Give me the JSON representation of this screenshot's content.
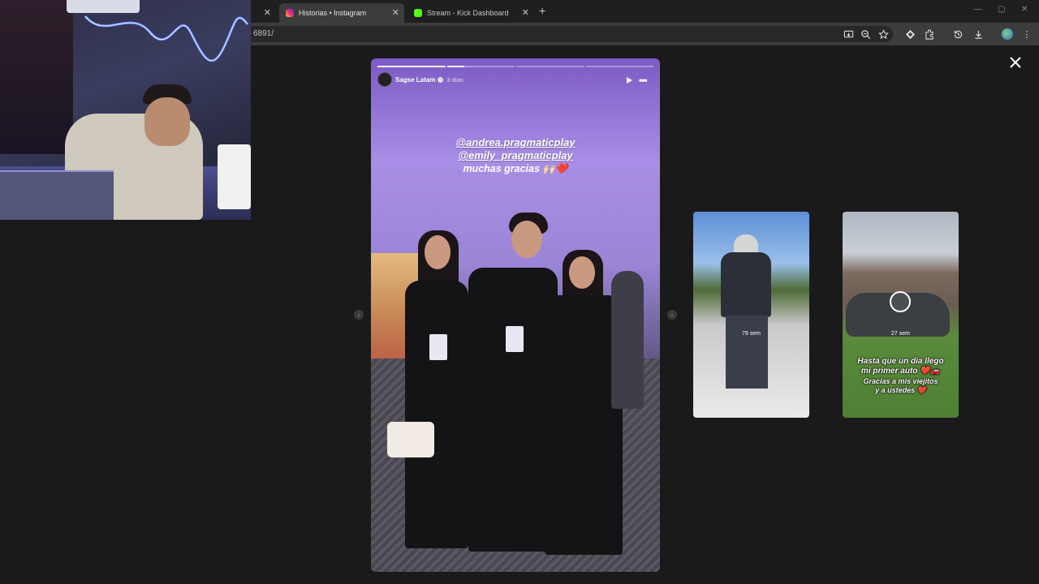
{
  "browser": {
    "tabs": [
      {
        "label": "",
        "active": false
      },
      {
        "label": "Historias • Instagram",
        "active": true
      },
      {
        "label": "Stream - Kick Dashboard",
        "active": false
      }
    ],
    "address": "6891/",
    "window_controls": [
      "—",
      "▢",
      "✕"
    ]
  },
  "story": {
    "username": "Sagse Latam",
    "time_ago": "3 días",
    "mention_1": "@andrea.pragmaticplay",
    "mention_2": "@emily_pragmaticplay",
    "thanks_text": "muchas gracias 🙌🏻❤️",
    "progress_segments": 4,
    "active_segment": 2
  },
  "previews": [
    {
      "time_label": "79 sem"
    },
    {
      "time_label": "27 sem",
      "line_1": "Hasta que un dia llego",
      "line_2": "mi primer auto ❤️🚗",
      "line_3": "Gracias a mis viejitos",
      "line_4": "y a ustedes ❤️"
    }
  ],
  "icons": {
    "close": "close-icon",
    "play": "play-icon",
    "more": "more-icon",
    "prev": "chevron-left-icon",
    "next": "chevron-right-icon"
  }
}
